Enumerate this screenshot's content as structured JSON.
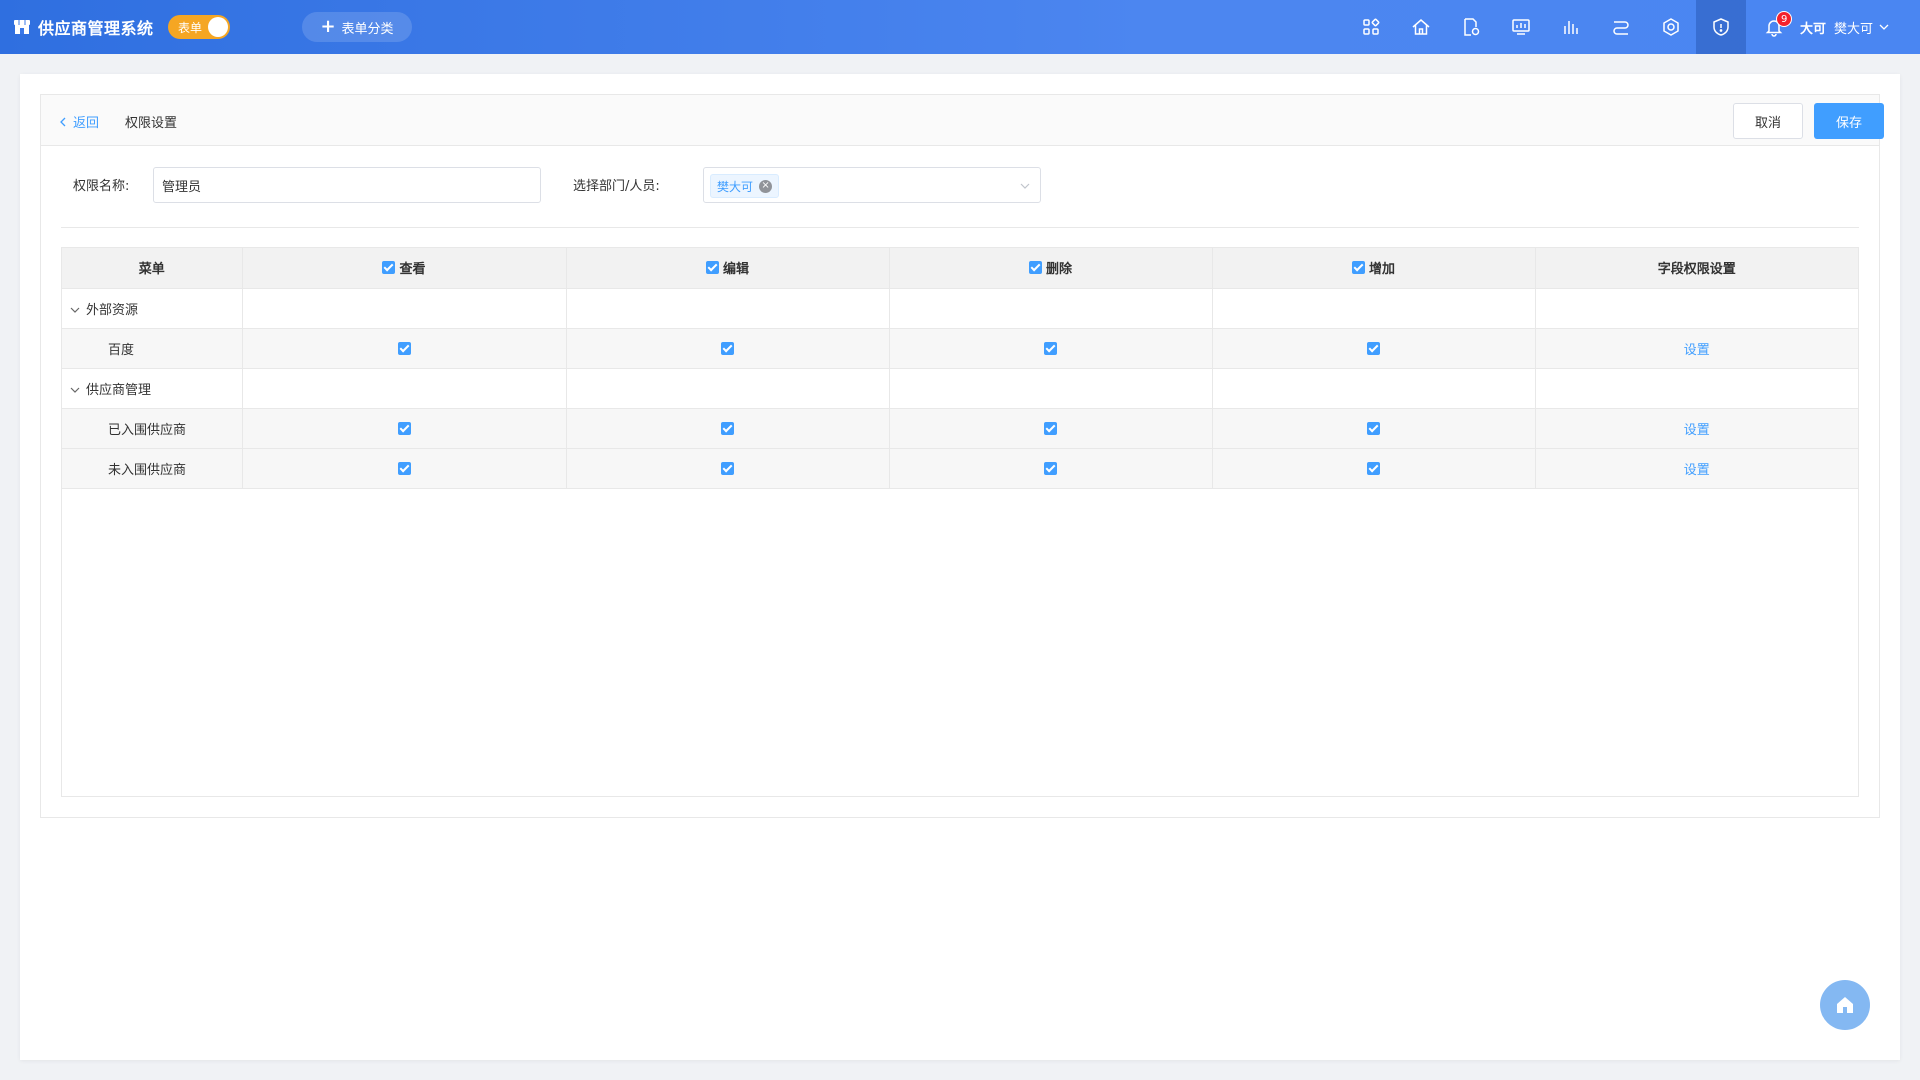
{
  "app": {
    "title": "供应商管理系统",
    "toggle_label": "表单",
    "category_button": "表单分类"
  },
  "nav": {
    "icons": [
      "apps-icon",
      "home-icon",
      "document-settings-icon",
      "monitor-chart-icon",
      "bar-chart-icon",
      "flow-icon",
      "settings-icon",
      "shield-icon"
    ],
    "active_index": 7
  },
  "notifications": {
    "count": "9"
  },
  "user": {
    "avatar_text": "大可",
    "name": "樊大可"
  },
  "header": {
    "back_label": "返回",
    "title": "权限设置",
    "cancel_label": "取消",
    "save_label": "保存"
  },
  "form": {
    "name_label": "权限名称:",
    "name_value": "管理员",
    "dept_label": "选择部门/人员:",
    "dept_tag": "樊大可"
  },
  "table": {
    "columns": [
      "菜单",
      "查看",
      "编辑",
      "删除",
      "增加",
      "字段权限设置"
    ],
    "rows": [
      {
        "type": "group",
        "label": "外部资源"
      },
      {
        "type": "child",
        "label": "百度",
        "view": true,
        "edit": true,
        "delete": true,
        "add": true,
        "setting": "设置"
      },
      {
        "type": "group",
        "label": "供应商管理"
      },
      {
        "type": "child",
        "label": "已入围供应商",
        "view": true,
        "edit": true,
        "delete": true,
        "add": true,
        "setting": "设置"
      },
      {
        "type": "child",
        "label": "未入围供应商",
        "view": true,
        "edit": true,
        "delete": true,
        "add": true,
        "setting": "设置"
      }
    ]
  },
  "colors": {
    "topbar": "#3a78e8",
    "accent": "#409eff",
    "toggle": "#f5a623",
    "badge": "#f5222d"
  }
}
